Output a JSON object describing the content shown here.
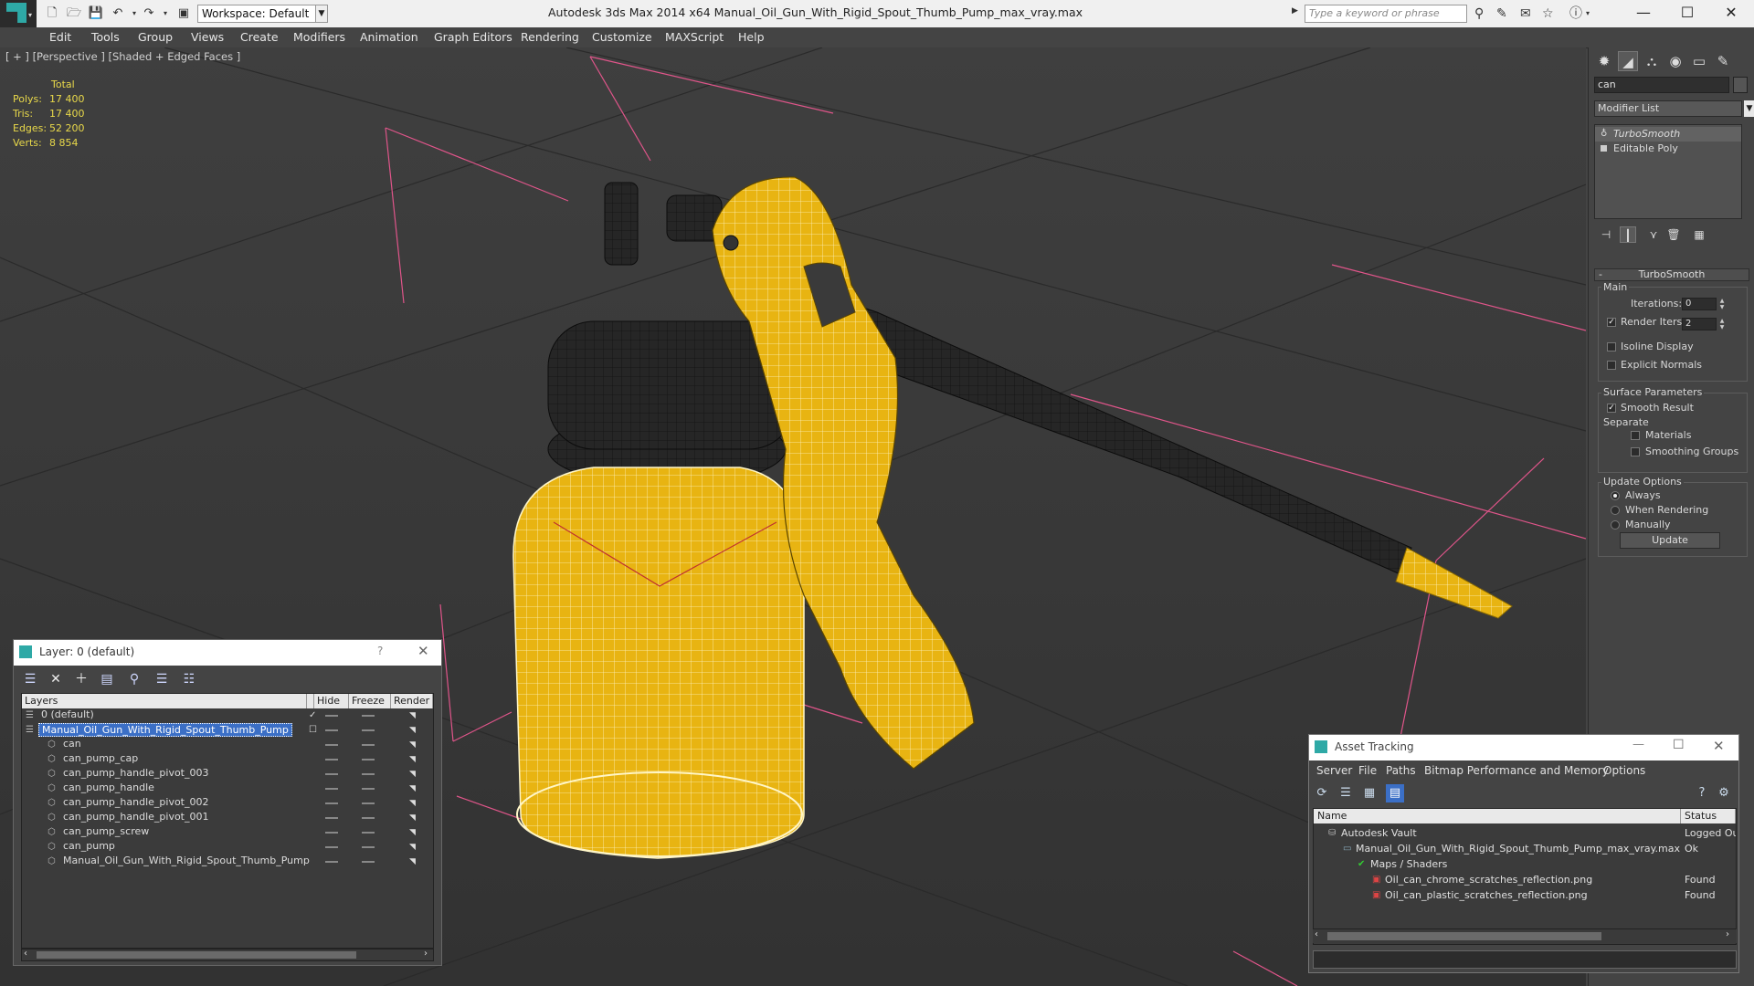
{
  "titlebar": {
    "workspace": "Workspace: Default",
    "app_title": "Autodesk 3ds Max  2014 x64      Manual_Oil_Gun_With_Rigid_Spout_Thumb_Pump_max_vray.max",
    "search_placeholder": "Type a keyword or phrase"
  },
  "menu": [
    "Edit",
    "Tools",
    "Group",
    "Views",
    "Create",
    "Modifiers",
    "Animation",
    "Graph Editors",
    "Rendering",
    "Customize",
    "MAXScript",
    "Help"
  ],
  "viewport": {
    "label": "[ + ] [Perspective ] [Shaded + Edged Faces ]",
    "stats_header": "Total",
    "stats": [
      {
        "label": "Polys:",
        "value": "17 400"
      },
      {
        "label": "Tris:",
        "value": "17 400"
      },
      {
        "label": "Edges:",
        "value": "52 200"
      },
      {
        "label": "Verts:",
        "value": "8 854"
      }
    ]
  },
  "command_panel": {
    "object_name": "can",
    "modifier_list": "Modifier List",
    "stack": [
      "TurboSmooth",
      "Editable Poly"
    ],
    "rollout_title": "TurboSmooth",
    "main_label": "Main",
    "iterations_label": "Iterations:",
    "iterations_value": "0",
    "render_iters_label": "Render Iters:",
    "render_iters_value": "2",
    "isoline_label": "Isoline Display",
    "explicit_normals_label": "Explicit Normals",
    "surface_label": "Surface Parameters",
    "smooth_result_label": "Smooth Result",
    "separate_label": "Separate",
    "materials_label": "Materials",
    "smoothing_groups_label": "Smoothing Groups",
    "update_options_label": "Update Options",
    "always_label": "Always",
    "when_rendering_label": "When Rendering",
    "manually_label": "Manually",
    "update_button": "Update"
  },
  "layer_dialog": {
    "title": "Layer: 0 (default)",
    "help": "?",
    "columns": [
      "Layers",
      "Hide",
      "Freeze",
      "Render"
    ],
    "rows": [
      {
        "name": "0 (default)",
        "level": 0,
        "type": "layer"
      },
      {
        "name": "Manual_Oil_Gun_With_Rigid_Spout_Thumb_Pump",
        "level": 0,
        "type": "layer",
        "selected": true
      },
      {
        "name": "can",
        "level": 1,
        "type": "object"
      },
      {
        "name": "can_pump_cap",
        "level": 1,
        "type": "object"
      },
      {
        "name": "can_pump_handle_pivot_003",
        "level": 1,
        "type": "object"
      },
      {
        "name": "can_pump_handle",
        "level": 1,
        "type": "object"
      },
      {
        "name": "can_pump_handle_pivot_002",
        "level": 1,
        "type": "object"
      },
      {
        "name": "can_pump_handle_pivot_001",
        "level": 1,
        "type": "object"
      },
      {
        "name": "can_pump_screw",
        "level": 1,
        "type": "object"
      },
      {
        "name": "can_pump",
        "level": 1,
        "type": "object"
      },
      {
        "name": "Manual_Oil_Gun_With_Rigid_Spout_Thumb_Pump",
        "level": 1,
        "type": "object"
      }
    ]
  },
  "asset_dialog": {
    "title": "Asset Tracking",
    "menu": [
      "Server",
      "File",
      "Paths",
      "Bitmap Performance and Memory",
      "Options"
    ],
    "columns": [
      "Name",
      "Status"
    ],
    "rows": [
      {
        "name": "Autodesk Vault",
        "status": "Logged Out",
        "level": 0
      },
      {
        "name": "Manual_Oil_Gun_With_Rigid_Spout_Thumb_Pump_max_vray.max",
        "status": "Ok",
        "level": 1
      },
      {
        "name": "Maps / Shaders",
        "status": "",
        "level": 2
      },
      {
        "name": "Oil_can_chrome_scratches_reflection.png",
        "status": "Found",
        "level": 3
      },
      {
        "name": "Oil_can_plastic_scratches_reflection.png",
        "status": "Found",
        "level": 3
      }
    ]
  },
  "colors": {
    "yellow": "#e8b412",
    "dark": "#222222",
    "stat_text": "#e9d94a",
    "selection": "#3b6fc6"
  }
}
